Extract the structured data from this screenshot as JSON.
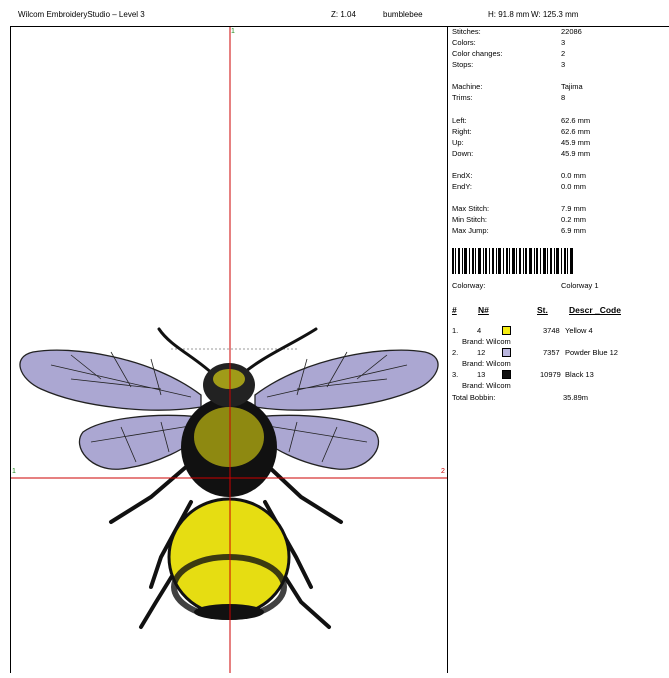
{
  "header": {
    "app_title": "Wilcom EmbroideryStudio – Level 3",
    "zoom": "Z: 1.04",
    "design_name": "bumblebee",
    "height": "H: 91.8 mm",
    "width": "W: 125.3 mm"
  },
  "canvas": {
    "marker_top": "1",
    "marker_left": "1",
    "marker_right": "2",
    "crosshair_color": "#cc0000"
  },
  "stats": {
    "stitches_label": "Stitches:",
    "stitches": "22086",
    "colors_label": "Colors:",
    "colors": "3",
    "color_changes_label": "Color changes:",
    "color_changes": "2",
    "stops_label": "Stops:",
    "stops": "3",
    "machine_label": "Machine:",
    "machine": "Tajima",
    "trims_label": "Trims:",
    "trims": "8",
    "left_label": "Left:",
    "left": "62.6 mm",
    "right_label": "Right:",
    "right": "62.6 mm",
    "up_label": "Up:",
    "up": "45.9 mm",
    "down_label": "Down:",
    "down": "45.9 mm",
    "endx_label": "EndX:",
    "endx": "0.0 mm",
    "endy_label": "EndY:",
    "endy": "0.0 mm",
    "max_stitch_label": "Max Stitch:",
    "max_stitch": "7.9 mm",
    "min_stitch_label": "Min Stitch:",
    "min_stitch": "0.2 mm",
    "max_jump_label": "Max Jump:",
    "max_jump": "6.9 mm"
  },
  "colorway": {
    "label": "Colorway:",
    "value": "Colorway 1"
  },
  "table": {
    "headers": {
      "num": "#",
      "n": "N#",
      "st": "St.",
      "descr": "Descr _Code"
    },
    "rows": [
      {
        "num": "1.",
        "n": "4",
        "color": "#f5ec12",
        "st": "3748",
        "descr": "Yellow 4",
        "brand": "Brand: Wilcom"
      },
      {
        "num": "2.",
        "n": "12",
        "color": "#b9b5dd",
        "st": "7357",
        "descr": "Powder Blue 12",
        "brand": "Brand: Wilcom"
      },
      {
        "num": "3.",
        "n": "13",
        "color": "#111111",
        "st": "10979",
        "descr": "Black 13",
        "brand": "Brand: Wilcom"
      }
    ],
    "total_label": "Total Bobbin:",
    "total_value": "35.89m"
  }
}
